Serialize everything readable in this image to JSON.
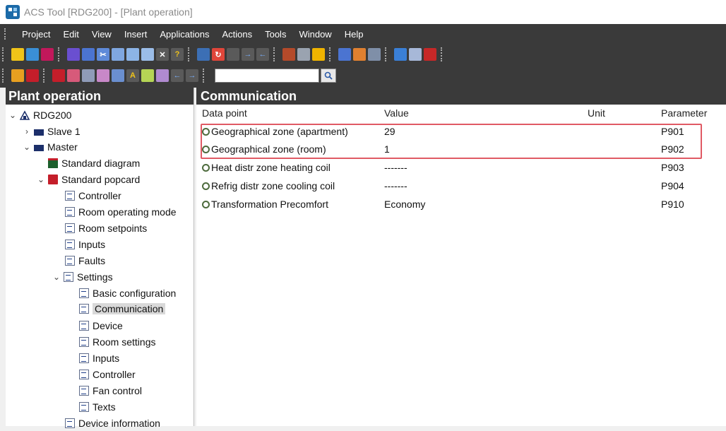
{
  "window": {
    "title": "ACS Tool [RDG200] - [Plant operation]"
  },
  "menu": [
    "Project",
    "Edit",
    "View",
    "Insert",
    "Applications",
    "Actions",
    "Tools",
    "Window",
    "Help"
  ],
  "toolbar": {
    "search_value": ""
  },
  "left_panel": {
    "title": "Plant operation",
    "tree": {
      "root": "RDG200",
      "slave": "Slave 1",
      "master": "Master",
      "standard_diagram": "Standard diagram",
      "standard_popcard": "Standard popcard",
      "controller": "Controller",
      "room_operating_mode": "Room operating mode",
      "room_setpoints": "Room setpoints",
      "inputs": "Inputs",
      "faults": "Faults",
      "settings": "Settings",
      "basic_configuration": "Basic configuration",
      "communication": "Communication",
      "device": "Device",
      "room_settings": "Room settings",
      "settings_inputs": "Inputs",
      "settings_controller": "Controller",
      "fan_control": "Fan control",
      "texts": "Texts",
      "device_information": "Device information"
    }
  },
  "main_panel": {
    "title": "Communication",
    "columns": [
      "Data point",
      "Value",
      "Unit",
      "Parameter"
    ],
    "rows": [
      {
        "data_point": "Geographical zone (apartment)",
        "value": "29",
        "unit": "",
        "parameter": "P901"
      },
      {
        "data_point": "Geographical zone (room)",
        "value": "1",
        "unit": "",
        "parameter": "P902"
      },
      {
        "data_point": "Heat distr zone heating coil",
        "value": "-------",
        "unit": "",
        "parameter": "P903"
      },
      {
        "data_point": "Refrig distr zone cooling coil",
        "value": "-------",
        "unit": "",
        "parameter": "P904"
      },
      {
        "data_point": "Transformation Precomfort",
        "value": "Economy",
        "unit": "",
        "parameter": "P910"
      }
    ]
  },
  "colors": {
    "highlight_border": "#e05a64",
    "header_bg": "#3a3a3a",
    "selection_bg": "#d9d9d9"
  }
}
